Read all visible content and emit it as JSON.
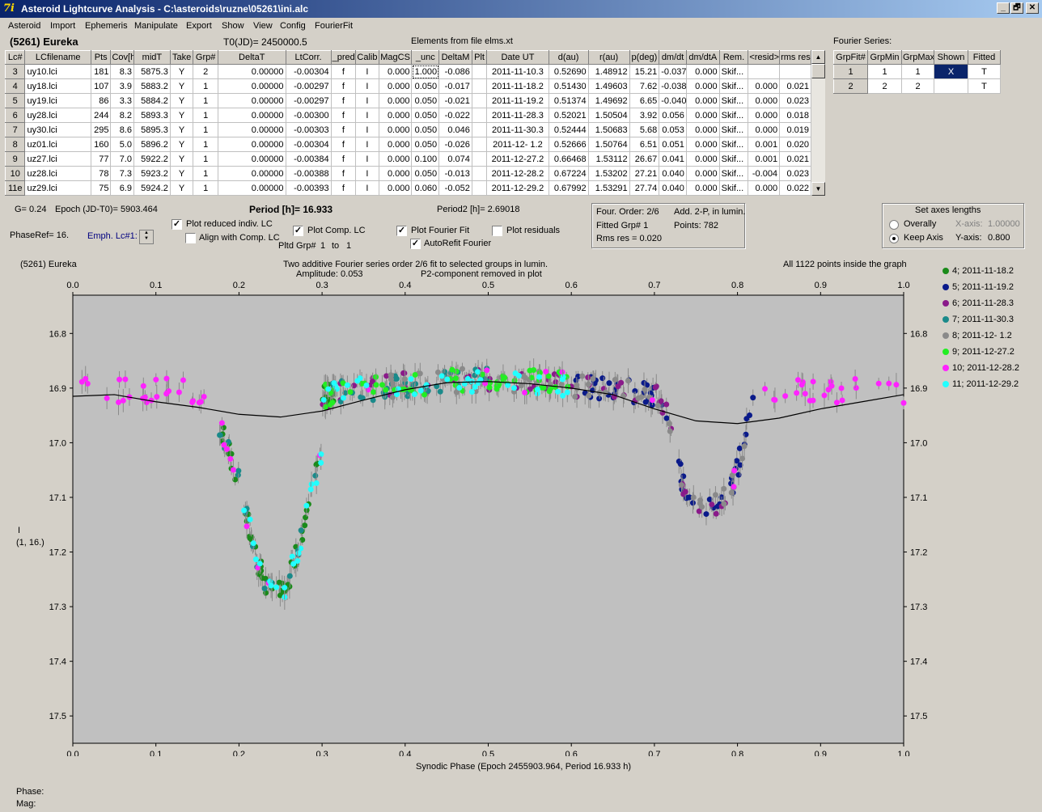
{
  "window": {
    "title": "Asteroid Lightcurve Analysis - C:\\asteroids\\ruzne\\05261\\ini.alc",
    "icon": "ala-logo-icon",
    "minimize": "_",
    "maximize": "🗗",
    "close": "✕"
  },
  "menu": [
    "Asteroid",
    "Import",
    "Ephemeris",
    "Manipulate",
    "Export",
    "Show",
    "View",
    "Config",
    "FourierFit"
  ],
  "header": {
    "object": "(5261) Eureka",
    "t0": "T0(JD)= 2450000.5",
    "elements": "Elements from file elms.xt"
  },
  "lc_table": {
    "columns": [
      "Lc#",
      "LCfilename",
      "Pts",
      "Cov[h]",
      "midT",
      "Take",
      "Grp#",
      "DeltaT",
      "LtCorr.",
      "_pred",
      "Calib",
      "MagCS",
      "_unc",
      "DeltaM",
      "Plt",
      "Date UT",
      "d(au)",
      "r(au)",
      "p(deg)",
      "dm/dt",
      "dm/dtA",
      "Rem.",
      "<resid>",
      "rms res"
    ],
    "rows": [
      [
        "3",
        "uy10.lci",
        "181",
        "8.3",
        "5875.3",
        "Y",
        "2",
        "0.00000",
        "-0.00304",
        "f",
        "I",
        "0.000",
        "1.000",
        "-0.086",
        "",
        "2011-11-10.3",
        "0.52690",
        "1.48912",
        "15.21",
        "-0.037",
        "0.000",
        "Skif...",
        "",
        ""
      ],
      [
        "4",
        "uy18.lci",
        "107",
        "3.9",
        "5883.2",
        "Y",
        "1",
        "0.00000",
        "-0.00297",
        "f",
        "I",
        "0.000",
        "0.050",
        "-0.017",
        "",
        "2011-11-18.2",
        "0.51430",
        "1.49603",
        "7.62",
        "-0.038",
        "0.000",
        "Skif...",
        "0.000",
        "0.021"
      ],
      [
        "5",
        "uy19.lci",
        "86",
        "3.3",
        "5884.2",
        "Y",
        "1",
        "0.00000",
        "-0.00297",
        "f",
        "I",
        "0.000",
        "0.050",
        "-0.021",
        "",
        "2011-11-19.2",
        "0.51374",
        "1.49692",
        "6.65",
        "-0.040",
        "0.000",
        "Skif...",
        "0.000",
        "0.023"
      ],
      [
        "6",
        "uy28.lci",
        "244",
        "8.2",
        "5893.3",
        "Y",
        "1",
        "0.00000",
        "-0.00300",
        "f",
        "I",
        "0.000",
        "0.050",
        "-0.022",
        "",
        "2011-11-28.3",
        "0.52021",
        "1.50504",
        "3.92",
        "0.056",
        "0.000",
        "Skif...",
        "0.000",
        "0.018"
      ],
      [
        "7",
        "uy30.lci",
        "295",
        "8.6",
        "5895.3",
        "Y",
        "1",
        "0.00000",
        "-0.00303",
        "f",
        "I",
        "0.000",
        "0.050",
        "0.046",
        "",
        "2011-11-30.3",
        "0.52444",
        "1.50683",
        "5.68",
        "0.053",
        "0.000",
        "Skif...",
        "0.000",
        "0.019"
      ],
      [
        "8",
        "uz01.lci",
        "160",
        "5.0",
        "5896.2",
        "Y",
        "1",
        "0.00000",
        "-0.00304",
        "f",
        "I",
        "0.000",
        "0.050",
        "-0.026",
        "",
        "2011-12- 1.2",
        "0.52666",
        "1.50764",
        "6.51",
        "0.051",
        "0.000",
        "Skif...",
        "0.001",
        "0.020"
      ],
      [
        "9",
        "uz27.lci",
        "77",
        "7.0",
        "5922.2",
        "Y",
        "1",
        "0.00000",
        "-0.00384",
        "f",
        "I",
        "0.000",
        "0.100",
        "0.074",
        "",
        "2011-12-27.2",
        "0.66468",
        "1.53112",
        "26.67",
        "0.041",
        "0.000",
        "Skif...",
        "0.001",
        "0.021"
      ],
      [
        "10",
        "uz28.lci",
        "78",
        "7.3",
        "5923.2",
        "Y",
        "1",
        "0.00000",
        "-0.00388",
        "f",
        "I",
        "0.000",
        "0.050",
        "-0.013",
        "",
        "2011-12-28.2",
        "0.67224",
        "1.53202",
        "27.21",
        "0.040",
        "0.000",
        "Skif...",
        "-0.004",
        "0.023"
      ],
      [
        "11e",
        "uz29.lci",
        "75",
        "6.9",
        "5924.2",
        "Y",
        "1",
        "0.00000",
        "-0.00393",
        "f",
        "I",
        "0.000",
        "0.060",
        "-0.052",
        "",
        "2011-12-29.2",
        "0.67992",
        "1.53291",
        "27.74",
        "0.040",
        "0.000",
        "Skif...",
        "0.000",
        "0.022"
      ]
    ]
  },
  "fourier_panel": {
    "title": "Fourier Series:",
    "columns": [
      "GrpFit#",
      "GrpMin",
      "GrpMax",
      "Shown",
      "Fitted"
    ],
    "rows": [
      [
        "1",
        "1",
        "1",
        "X",
        "T"
      ],
      [
        "2",
        "2",
        "2",
        "",
        "T"
      ]
    ]
  },
  "controls": {
    "g": "G= 0.24",
    "epoch": "Epoch (JD-T0)= 5903.464",
    "period": "Period [h]= 16.933",
    "period2": "Period2 [h]= 2.69018",
    "phaseref": "PhaseRef= 16.",
    "emph": "Emph. Lc#1:",
    "plot_reduced": "Plot reduced indiv. LC",
    "align": "Align with Comp. LC",
    "plot_comp": "Plot Comp. LC",
    "pltd_grp": "Pltd Grp#",
    "pltd_from": "1",
    "pltd_to_label": "to",
    "pltd_to": "1",
    "plot_fourier": "Plot Fourier Fit",
    "autorefit": "AutoRefit Fourier",
    "plot_resid": "Plot residuals",
    "check_mark": "✓"
  },
  "fit_info": {
    "order": "Four. Order:  2/6",
    "add": "Add. 2-P, in lumin.",
    "fitted": "Fitted Grp# 1",
    "points": "Points: 782",
    "rms": "Rms res      = 0.020"
  },
  "axes_box": {
    "title": "Set axes lengths",
    "overally": "Overally",
    "keep": "Keep Axis",
    "xaxis_label": "X-axis:",
    "xaxis": "1.00000",
    "yaxis_label": "Y-axis:",
    "yaxis": "0.800"
  },
  "plot": {
    "left_title": "(5261) Eureka",
    "center_title1": "Two additive Fourier series order 2/6 fit to selected groups in lumin.",
    "center_title2a": "Amplitude: 0.053",
    "center_title2b": "P2-component removed in plot",
    "right_title": "All 1122 points inside the graph",
    "ylabel1": "I",
    "ylabel2": "(1, 16.)",
    "xlabel": "Synodic Phase (Epoch 2455903.964, Period 16.933 h)"
  },
  "chart_data": {
    "type": "scatter",
    "xlim": [
      0,
      1
    ],
    "ylim": [
      17.55,
      16.73
    ],
    "y_inverted": true,
    "x_ticks": [
      "0.0",
      "0.1",
      "0.2",
      "0.3",
      "0.4",
      "0.5",
      "0.6",
      "0.7",
      "0.8",
      "0.9",
      "1.0"
    ],
    "y_ticks": [
      "16.8",
      "16.9",
      "17.0",
      "17.1",
      "17.2",
      "17.3",
      "17.4",
      "17.5"
    ],
    "grid": false,
    "legend_position": "right",
    "background": "#c0c0c0",
    "fit_color": "#000000",
    "series": [
      {
        "name": "4; 2011-11-18.2",
        "color": "#1a8a1a"
      },
      {
        "name": "5; 2011-11-19.2",
        "color": "#0a1a8a"
      },
      {
        "name": "6; 2011-11-28.3",
        "color": "#8a1a8a"
      },
      {
        "name": "7; 2011-11-30.3",
        "color": "#1a8a8a"
      },
      {
        "name": "8; 2011-12- 1.2",
        "color": "#8a8a8a"
      },
      {
        "name": "9; 2011-12-27.2",
        "color": "#22ee22"
      },
      {
        "name": "10; 2011-12-28.2",
        "color": "#ff22ff"
      },
      {
        "name": "11; 2011-12-29.2",
        "color": "#22ffff"
      }
    ],
    "fourier_fit": [
      [
        0,
        16.915
      ],
      [
        0.05,
        16.912
      ],
      [
        0.1,
        16.925
      ],
      [
        0.15,
        16.935
      ],
      [
        0.2,
        16.948
      ],
      [
        0.25,
        16.953
      ],
      [
        0.3,
        16.942
      ],
      [
        0.35,
        16.922
      ],
      [
        0.4,
        16.903
      ],
      [
        0.45,
        16.89
      ],
      [
        0.5,
        16.888
      ],
      [
        0.55,
        16.892
      ],
      [
        0.6,
        16.9
      ],
      [
        0.65,
        16.912
      ],
      [
        0.7,
        16.938
      ],
      [
        0.75,
        16.96
      ],
      [
        0.8,
        16.965
      ],
      [
        0.85,
        16.955
      ],
      [
        0.9,
        16.938
      ],
      [
        0.95,
        16.925
      ],
      [
        1.0,
        16.912
      ]
    ]
  }
}
